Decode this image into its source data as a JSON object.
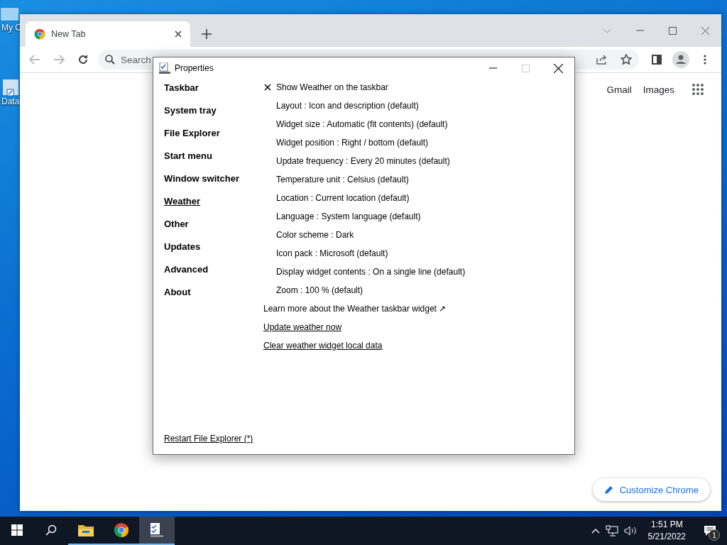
{
  "desktop": {
    "icons": [
      {
        "kind": "computer",
        "label": "My C"
      },
      {
        "kind": "shortcut",
        "label": "Data"
      }
    ]
  },
  "browser": {
    "tab": {
      "title": "New Tab",
      "selected": true
    },
    "address_bar": {
      "placeholder": "Search"
    },
    "header_links": [
      "Gmail",
      "Images"
    ],
    "customize_button": "Customize Chrome"
  },
  "dialog": {
    "title": "Properties",
    "sidebar": [
      {
        "label": "Taskbar",
        "selected": false
      },
      {
        "label": "System tray",
        "selected": false
      },
      {
        "label": "File Explorer",
        "selected": false
      },
      {
        "label": "Start menu",
        "selected": false
      },
      {
        "label": "Window switcher",
        "selected": false
      },
      {
        "label": "Weather",
        "selected": true
      },
      {
        "label": "Other",
        "selected": false
      },
      {
        "label": "Updates",
        "selected": false
      },
      {
        "label": "Advanced",
        "selected": false
      },
      {
        "label": "About",
        "selected": false
      }
    ],
    "settings": [
      {
        "kind": "checkbox",
        "label": "Show Weather on the taskbar",
        "checked": true
      },
      {
        "kind": "option",
        "label": "Layout : Icon and description (default)"
      },
      {
        "kind": "option",
        "label": "Widget size : Automatic (fit contents) (default)"
      },
      {
        "kind": "option",
        "label": "Widget position : Right / bottom (default)"
      },
      {
        "kind": "option",
        "label": "Update frequency : Every 20 minutes (default)"
      },
      {
        "kind": "option",
        "label": "Temperature unit : Celsius (default)"
      },
      {
        "kind": "option",
        "label": "Location : Current location (default)"
      },
      {
        "kind": "option",
        "label": "Language : System language (default)"
      },
      {
        "kind": "option",
        "label": "Color scheme : Dark"
      },
      {
        "kind": "option",
        "label": "Icon pack : Microsoft (default)"
      },
      {
        "kind": "option",
        "label": "Display widget contents : On a single line (default)"
      },
      {
        "kind": "option",
        "label": "Zoom : 100 % (default)"
      }
    ],
    "links": [
      {
        "kind": "external",
        "label": "Learn more about the Weather taskbar widget ↗"
      },
      {
        "kind": "action",
        "label": "Update weather now"
      },
      {
        "kind": "action",
        "label": "Clear weather widget local data"
      }
    ],
    "footer_link": "Restart File Explorer (*)"
  },
  "taskbar": {
    "apps": [
      {
        "kind": "explorer",
        "selected": false
      },
      {
        "kind": "chrome",
        "selected": false
      },
      {
        "kind": "app",
        "selected": true
      }
    ],
    "time": "1:51 PM",
    "date": "5/21/2022",
    "notification_count": "1"
  }
}
